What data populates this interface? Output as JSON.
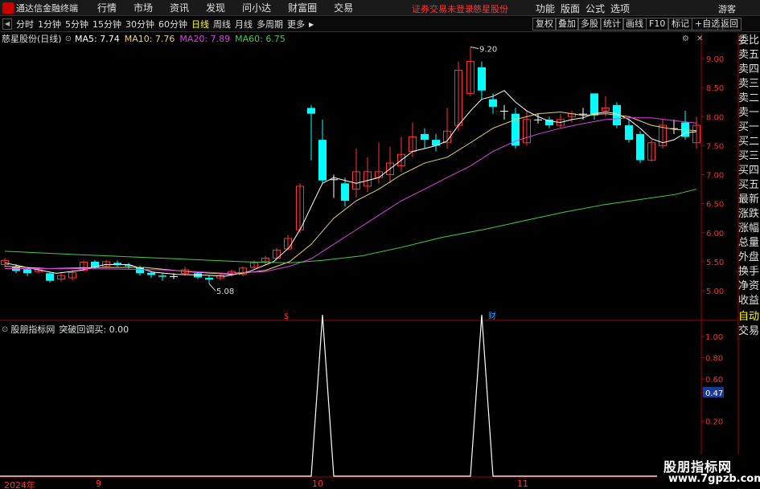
{
  "menubar": {
    "app_title": "通达信金融终端",
    "items": [
      "行情",
      "市场",
      "资讯",
      "发现",
      "问小达",
      "财富圈",
      "交易"
    ],
    "status_text": "证券交易未登录",
    "stock_name": "慈星股份",
    "right_items": [
      "功能",
      "版面",
      "公式",
      "选项"
    ],
    "guest_label": "游客"
  },
  "toolbar": {
    "periods": [
      "分时",
      "1分钟",
      "5分钟",
      "15分钟",
      "30分钟",
      "60分钟",
      "日线",
      "周线",
      "月线",
      "多周期",
      "更多"
    ],
    "active_period": "日线",
    "right_tools": [
      "复权",
      "叠加",
      "多股",
      "统计",
      "画线",
      "F10",
      "标记",
      "+自选",
      "返回"
    ]
  },
  "main_pane": {
    "title": "慈星股份(日线)",
    "ma_labels": [
      {
        "text": "MA5: 7.74",
        "color": "#ffffff"
      },
      {
        "text": "MA10: 7.76",
        "color": "#e8d36a"
      },
      {
        "text": "MA20: 7.89",
        "color": "#e040e0"
      },
      {
        "text": "MA60: 6.75",
        "color": "#40d040"
      }
    ],
    "price_ticks": [
      "9.00",
      "8.50",
      "8.00",
      "7.50",
      "7.00",
      "6.50",
      "6.00",
      "5.50",
      "5.00"
    ],
    "high_label": "9.20",
    "low_label": "5.08",
    "event_markers": [
      "$",
      "财"
    ]
  },
  "sidebar": {
    "items": [
      {
        "text": "委比",
        "color": "white"
      },
      {
        "text": "卖五",
        "color": "white"
      },
      {
        "text": "卖四",
        "color": "white"
      },
      {
        "text": "卖三",
        "color": "white"
      },
      {
        "text": "卖二",
        "color": "white"
      },
      {
        "text": "卖一",
        "color": "white"
      },
      {
        "text": "买一",
        "color": "white"
      },
      {
        "text": "买二",
        "color": "white"
      },
      {
        "text": "买三",
        "color": "white"
      },
      {
        "text": "买四",
        "color": "white"
      },
      {
        "text": "买五",
        "color": "white"
      },
      {
        "text": "最新",
        "color": "white"
      },
      {
        "text": "涨跌",
        "color": "white"
      },
      {
        "text": "涨幅",
        "color": "white"
      },
      {
        "text": "总量",
        "color": "white"
      },
      {
        "text": "外盘",
        "color": "white"
      },
      {
        "text": "换手",
        "color": "white"
      },
      {
        "text": "净资",
        "color": "white"
      },
      {
        "text": "收益",
        "color": "white"
      },
      {
        "text": "自动",
        "color": "yellow"
      },
      {
        "text": "交易",
        "color": "white"
      }
    ]
  },
  "indicator_pane": {
    "title": "股朋指标网",
    "signal_label": "突破回调买: 0.00",
    "ticks": [
      "1.00",
      "0.80",
      "0.60",
      "0.47",
      "0.20",
      "0.00"
    ],
    "highlight_value": "0.47"
  },
  "date_axis": [
    "2024年",
    "9",
    "10",
    "11"
  ],
  "watermark": {
    "title": "股朋指标网",
    "url": "www.7gpzb.com"
  }
}
